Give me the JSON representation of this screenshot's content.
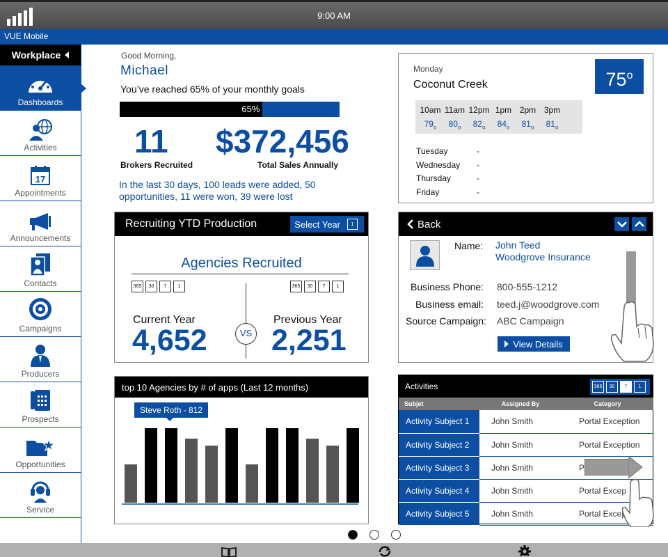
{
  "status": {
    "time": "9:00 AM"
  },
  "app": {
    "title": "VUE Mobile"
  },
  "sidebar": {
    "header": "Workplace",
    "items": [
      {
        "label": "Dashboards",
        "icon": "gauge-icon",
        "active": true
      },
      {
        "label": "Activities",
        "icon": "people-globe-icon"
      },
      {
        "label": "Appointments",
        "icon": "calendar-icon"
      },
      {
        "label": "Announcements",
        "icon": "megaphone-icon"
      },
      {
        "label": "Contacts",
        "icon": "contacts-icon"
      },
      {
        "label": "Campaigns",
        "icon": "target-icon"
      },
      {
        "label": "Producers",
        "icon": "person-icon"
      },
      {
        "label": "Prospects",
        "icon": "phone-icon"
      },
      {
        "label": "Opportunities",
        "icon": "folder-star-icon"
      },
      {
        "label": "Service",
        "icon": "headset-icon"
      }
    ]
  },
  "welcome": {
    "greeting": "Good Morning,",
    "name": "Michael",
    "goal_text": "You’ve reached 65% of your monthly goals",
    "progress_label": "65%",
    "progress_value": 0.65,
    "brokers_value": "11",
    "brokers_label": "Brokers Recruited",
    "sales_value": "$372,456",
    "sales_label": "Total Sales Annually",
    "summary": "In the last 30 days, 100 leads were added, 50 opportunities, 11 were won, 39 were lost"
  },
  "weather": {
    "day": "Monday",
    "city": "Coconut Creek",
    "temp": "75",
    "hours": [
      "10am",
      "11am",
      "12pm",
      "1pm",
      "2pm",
      "3pm"
    ],
    "temps": [
      "79",
      "80",
      "82",
      "84",
      "81",
      "81"
    ],
    "forecast": [
      {
        "day": "Tuesday",
        "value": "-"
      },
      {
        "day": "Wednesday",
        "value": "-"
      },
      {
        "day": "Thursday",
        "value": "-"
      },
      {
        "day": "Friday",
        "value": "-"
      }
    ]
  },
  "recruiting": {
    "title": "Recruiting YTD Production",
    "select_year": "Select Year",
    "subtitle": "Agencies Recruited",
    "cal_labels": [
      "365",
      "30",
      "7",
      "1"
    ],
    "current_label": "Current Year",
    "current_value": "4,652",
    "vs": "VS",
    "previous_label": "Previous Year",
    "previous_value": "2,251"
  },
  "contact": {
    "back": "Back",
    "name_label": "Name:",
    "name": "John Teed",
    "company": "Woodgrove Insurance",
    "phone_label": "Business  Phone:",
    "phone": "800-555-1212",
    "email_label": "Business  email:",
    "email": "teed.j@woodgrove.com",
    "campaign_label": "Source Campaign:",
    "campaign": "ABC Campaign",
    "view_details": "View Details"
  },
  "agencies": {
    "title": "top 10 Agencies by # of apps (Last 12 months)",
    "tooltip": "Steve Roth - 812"
  },
  "chart_data": {
    "type": "bar",
    "values": [
      55,
      107,
      107,
      92,
      82,
      107,
      55,
      107,
      107,
      92,
      82,
      107
    ],
    "colors": [
      "#555555",
      "#000000",
      "#000000",
      "#555555",
      "#555555",
      "#000000",
      "#555555",
      "#000000",
      "#000000",
      "#555555",
      "#555555",
      "#000000"
    ]
  },
  "activities": {
    "title": "Activities",
    "cal_labels": [
      "365",
      "30",
      "7",
      "1"
    ],
    "columns": [
      "Subjet",
      "Assigned By",
      "Category"
    ],
    "rows": [
      {
        "subject": "Activity Subject 1",
        "assigned": "John Smith",
        "category": "Portal Exception"
      },
      {
        "subject": "Activity Subject 2",
        "assigned": "John Smith",
        "category": "Portal Exception"
      },
      {
        "subject": "Activity Subject 3",
        "assigned": "John Smith",
        "category": "P"
      },
      {
        "subject": "Activity Subject 4",
        "assigned": "John Smith",
        "category": "Portal Excep"
      },
      {
        "subject": "Activity Subject 5",
        "assigned": "John Smith",
        "category": "Portal Excep"
      }
    ]
  }
}
